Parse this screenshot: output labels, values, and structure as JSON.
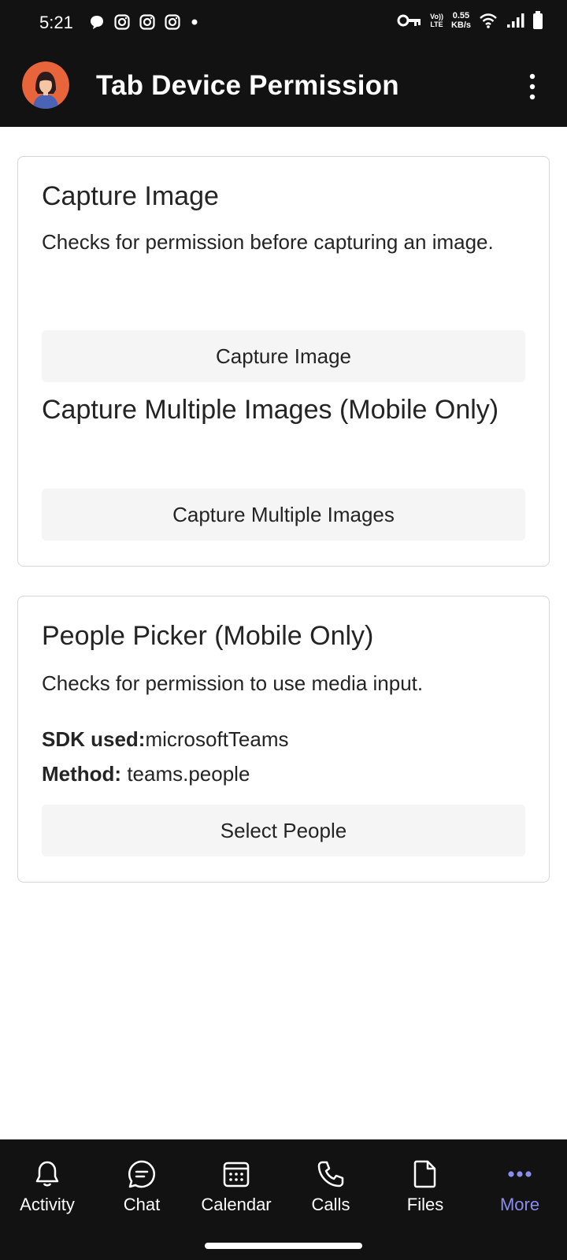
{
  "status_bar": {
    "time": "5:21",
    "network_speed_value": "0.55",
    "network_speed_unit": "KB/s",
    "volte_top": "Vo))",
    "volte_bottom": "LTE",
    "left_icons": [
      "chat-bubble-icon",
      "instagram-icon",
      "instagram-icon",
      "instagram-icon",
      "dot-icon"
    ],
    "right_icons": [
      "vpn-key-icon",
      "volte-icon",
      "wifi-icon",
      "signal-icon",
      "battery-icon"
    ]
  },
  "app_bar": {
    "title": "Tab Device Permission"
  },
  "cards": {
    "capture": {
      "title": "Capture Image",
      "description": "Checks for permission before capturing an image.",
      "button_label": "Capture Image",
      "multi_title": "Capture Multiple Images (Mobile Only)",
      "multi_button_label": "Capture Multiple Images"
    },
    "people": {
      "title": "People Picker (Mobile Only)",
      "description": "Checks for permission to use media input.",
      "sdk_label": "SDK used:",
      "sdk_value": "microsoftTeams",
      "method_label": "Method:",
      "method_value": " teams.people",
      "button_label": "Select People"
    }
  },
  "bottom_nav": {
    "items": [
      {
        "label": "Activity",
        "icon": "bell-icon"
      },
      {
        "label": "Chat",
        "icon": "chat-icon"
      },
      {
        "label": "Calendar",
        "icon": "calendar-icon"
      },
      {
        "label": "Calls",
        "icon": "phone-icon"
      },
      {
        "label": "Files",
        "icon": "file-icon"
      },
      {
        "label": "More",
        "icon": "more-icon"
      }
    ],
    "active": "More",
    "active_color": "#8b8cf0"
  },
  "colors": {
    "bar_background": "#121212",
    "button_background": "#f5f5f5",
    "card_border": "#d6d6d6"
  }
}
